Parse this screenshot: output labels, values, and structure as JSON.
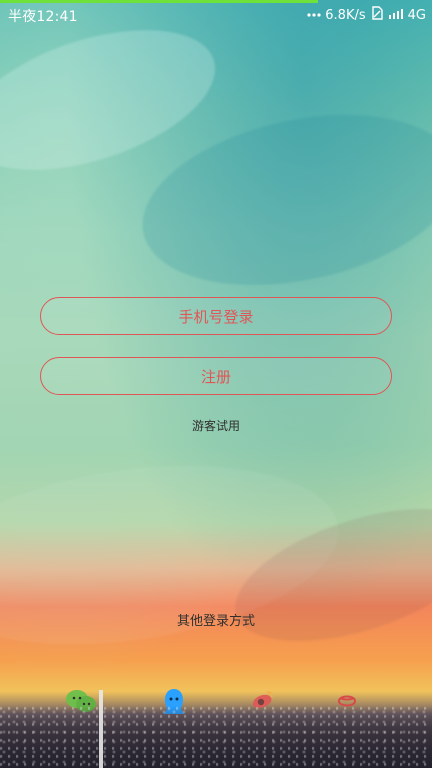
{
  "status_bar": {
    "time": "半夜12:41",
    "network_speed": "6.8K/s",
    "network_type": "4G",
    "progress_color": "#6ee13a",
    "icons": {
      "dots": "dots-icon",
      "sim": "sim-icon",
      "signal": "signal-icon"
    }
  },
  "actions": {
    "phone_login_label": "手机号登录",
    "register_label": "注册",
    "guest_label": "游客试用"
  },
  "other_login": {
    "title": "其他登录方式",
    "providers": [
      {
        "name": "wechat-icon",
        "color": "#6cc04a"
      },
      {
        "name": "qq-icon",
        "color": "#2aa0ff"
      },
      {
        "name": "weibo-icon",
        "color": "#e05656"
      },
      {
        "name": "other-login-icon",
        "color": "#d64a4a"
      }
    ]
  },
  "theme": {
    "accent": "#e05656",
    "text_dark": "#2f2f2f"
  }
}
